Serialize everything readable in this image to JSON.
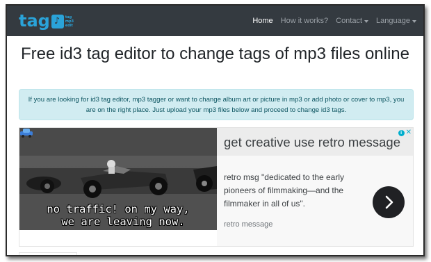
{
  "brand": {
    "logo_text": "tag",
    "logo_side_text": [
      "tag",
      "mp3",
      "edit"
    ],
    "logo_color": "#2aa3d9"
  },
  "nav": {
    "items": [
      {
        "label": "Home",
        "active": true
      },
      {
        "label": "How it works?",
        "active": false
      },
      {
        "label": "Contact",
        "dropdown": true
      },
      {
        "label": "Language",
        "dropdown": true
      }
    ],
    "bg_color": "#343a40"
  },
  "page": {
    "title": "Free id3 tag editor to change tags of mp3 files online",
    "info_text": "If you are looking for id3 tag editor, mp3 tagger or want to change album art or picture in mp3 or add photo or cover to mp3, you are on the right place. Just upload your mp3 files below and proceed to change id3 tags.",
    "info_bg": "#d1ecf1"
  },
  "ad": {
    "caption_line1": "no traffic! on my way,",
    "caption_line2": "we are leaving now.",
    "headline": "get creative use retro message",
    "body": "retro msg \"dedicated to the early pioneers of filmmaking—and the filmmaker in all of us\".",
    "source": "retro message",
    "icons": [
      "adchoices-icon",
      "close-icon",
      "chevron-right-icon",
      "car-icon"
    ]
  }
}
